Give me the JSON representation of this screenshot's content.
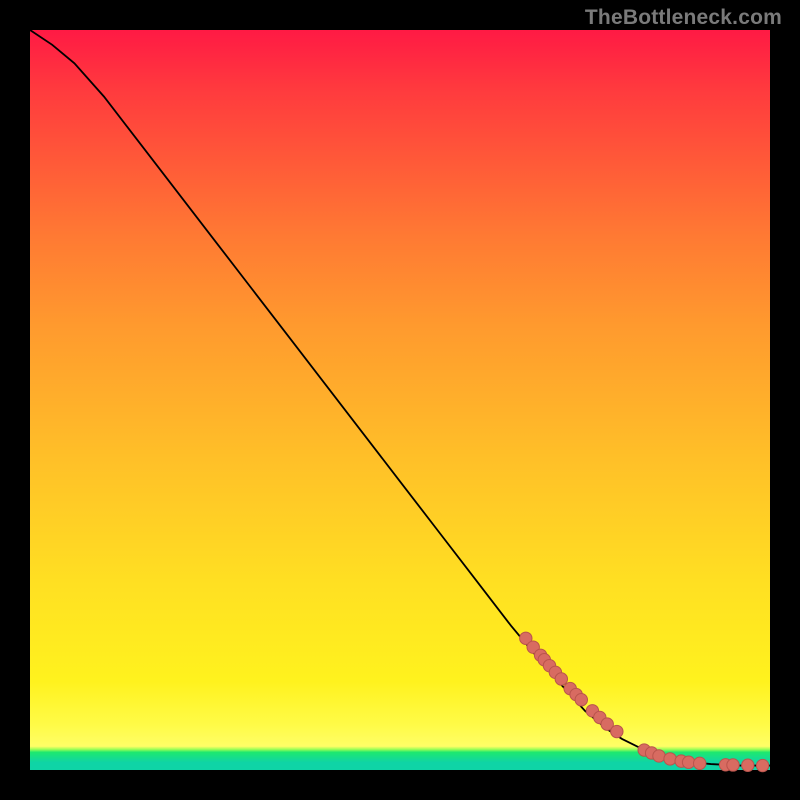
{
  "watermark": "TheBottleneck.com",
  "colors": {
    "background": "#000000",
    "curve": "#000000",
    "dot_fill": "#d86b61",
    "dot_stroke": "#b9544c",
    "gradient_top": "#ff1a44",
    "gradient_mid": "#ffe022",
    "gradient_green": "#0fd4a6"
  },
  "chart_data": {
    "type": "line",
    "title": "",
    "xlabel": "",
    "ylabel": "",
    "xlim": [
      0,
      100
    ],
    "ylim": [
      0,
      100
    ],
    "series": [
      {
        "name": "curve",
        "x": [
          0,
          3,
          6,
          10,
          15,
          20,
          25,
          30,
          35,
          40,
          45,
          50,
          55,
          60,
          65,
          70,
          75,
          78,
          80,
          82,
          84,
          86,
          88,
          90,
          92,
          94,
          96,
          98,
          100
        ],
        "y": [
          100,
          98,
          95.5,
          91,
          84.5,
          78,
          71.5,
          65,
          58.5,
          52,
          45.5,
          39,
          32.5,
          26,
          19.5,
          13.5,
          8,
          5.5,
          4.2,
          3.2,
          2.4,
          1.8,
          1.3,
          1.0,
          0.8,
          0.7,
          0.6,
          0.6,
          0.6
        ]
      }
    ],
    "scatter": [
      {
        "name": "dots-cluster",
        "x": [
          67,
          68,
          69,
          69.5,
          70.2,
          71,
          71.8,
          73,
          73.8,
          74.5,
          76,
          77,
          78,
          79.3,
          83,
          84,
          85,
          86.5,
          88,
          89,
          90.5,
          94,
          95,
          97,
          99
        ],
        "y": [
          17.8,
          16.6,
          15.5,
          14.9,
          14.1,
          13.2,
          12.3,
          11.0,
          10.2,
          9.5,
          8.0,
          7.1,
          6.2,
          5.2,
          2.7,
          2.3,
          1.9,
          1.5,
          1.2,
          1.05,
          0.9,
          0.7,
          0.68,
          0.64,
          0.6
        ]
      }
    ],
    "annotations": []
  }
}
